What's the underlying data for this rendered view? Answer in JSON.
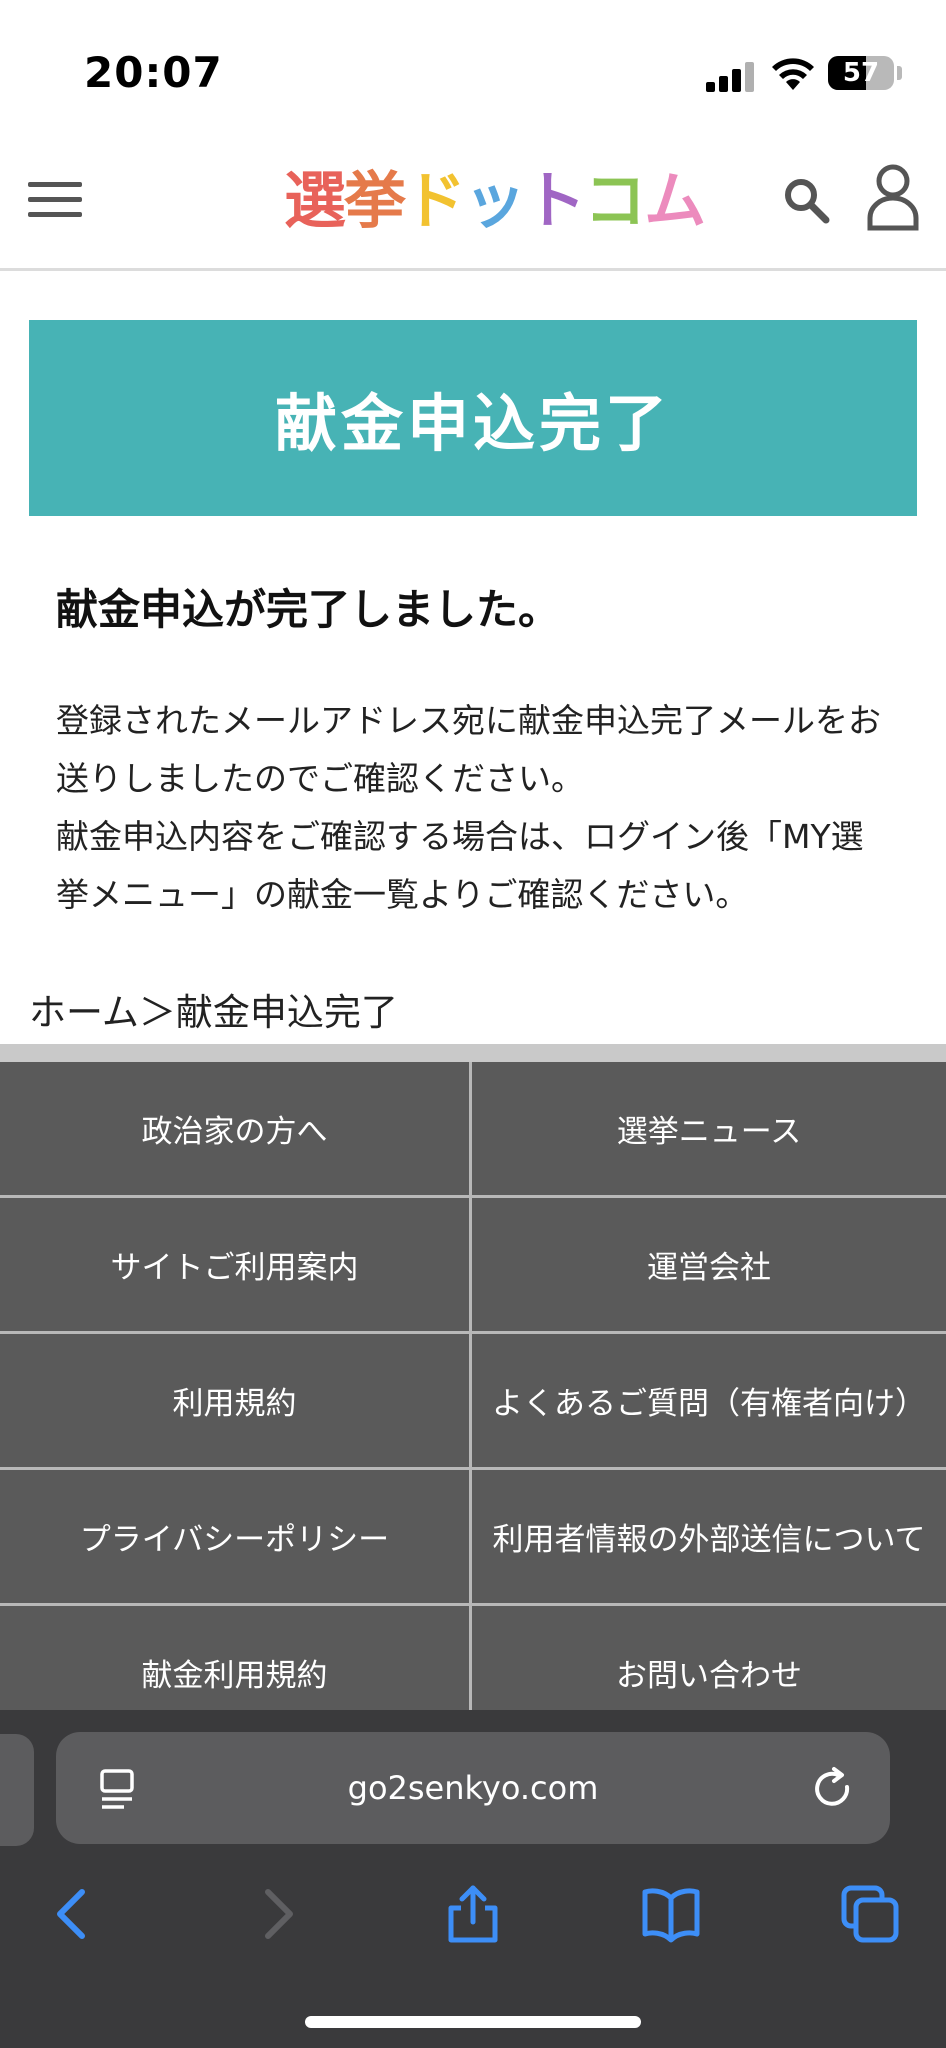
{
  "status_bar": {
    "time": "20:07",
    "battery_percent": 57
  },
  "header": {
    "logo_chars": [
      {
        "char": "選",
        "color": "#e8625a"
      },
      {
        "char": "挙",
        "color": "#e57a4a"
      },
      {
        "char": "ド",
        "color": "#f2c230"
      },
      {
        "char": "ッ",
        "color": "#5aa6de"
      },
      {
        "char": "ト",
        "color": "#a066c4"
      },
      {
        "char": "コ",
        "color": "#8cc454"
      },
      {
        "char": "ム",
        "color": "#ec8bbd"
      }
    ],
    "menu_icon": "hamburger-menu-icon",
    "search_icon": "search-icon",
    "user_icon": "user-icon"
  },
  "main": {
    "banner_title": "献金申込完了",
    "banner_color": "#47b3b5",
    "heading": "献金申込が完了しました。",
    "message_line1": "登録されたメールアドレス宛に献金申込完了メールをお送りしましたのでご確認ください。",
    "message_line2": "献金申込内容をご確認する場合は、ログイン後「MY選挙メニュー」の献金一覧よりご確認ください。"
  },
  "breadcrumb": {
    "home": "ホーム",
    "separator": "＞",
    "current": "献金申込完了"
  },
  "footer": {
    "links": [
      "政治家の方へ",
      "選挙ニュース",
      "サイトご利用案内",
      "運営会社",
      "利用規約",
      "よくあるご質問（有権者向け）",
      "プライバシーポリシー",
      "利用者情報の外部送信について",
      "献金利用規約",
      "お問い合わせ"
    ]
  },
  "browser": {
    "url": "go2senkyo.com",
    "reader_icon": "reader-mode-icon",
    "reload_icon": "reload-icon",
    "back_icon": "back-chevron-icon",
    "forward_icon": "forward-chevron-icon",
    "share_icon": "share-icon",
    "bookmarks_icon": "bookmarks-icon",
    "tabs_icon": "tabs-icon",
    "accent": "#3d8ef7"
  }
}
